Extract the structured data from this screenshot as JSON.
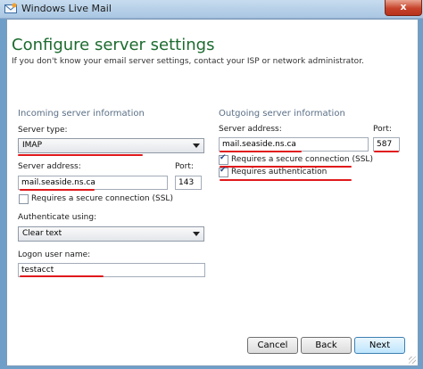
{
  "window": {
    "title": "Windows Live Mail",
    "close_glyph": "x",
    "app_icon": "envelope-icon"
  },
  "page": {
    "heading": "Configure server settings",
    "subtitle": "If you don't know your email server settings, contact your ISP or network administrator."
  },
  "incoming": {
    "section_title": "Incoming server information",
    "server_type_label": "Server type:",
    "server_type_value": "IMAP",
    "server_address_label": "Server address:",
    "server_address_value": "mail.seaside.ns.ca",
    "port_label": "Port:",
    "port_value": "143",
    "ssl_label": "Requires a secure connection (SSL)",
    "ssl_checked": false,
    "auth_label": "Authenticate using:",
    "auth_value": "Clear text",
    "logon_label": "Logon user name:",
    "logon_value": "testacct"
  },
  "outgoing": {
    "section_title": "Outgoing server information",
    "server_address_label": "Server address:",
    "server_address_value": "mail.seaside.ns.ca",
    "port_label": "Port:",
    "port_value": "587",
    "ssl_label": "Requires a secure connection (SSL)",
    "ssl_checked": true,
    "auth_required_label": "Requires authentication",
    "auth_required_checked": true
  },
  "buttons": {
    "cancel": "Cancel",
    "back": "Back",
    "next": "Next"
  },
  "colors": {
    "heading": "#1d6b2f",
    "annotation_underline": "#e0191c",
    "frame": "#6f9fc8"
  }
}
